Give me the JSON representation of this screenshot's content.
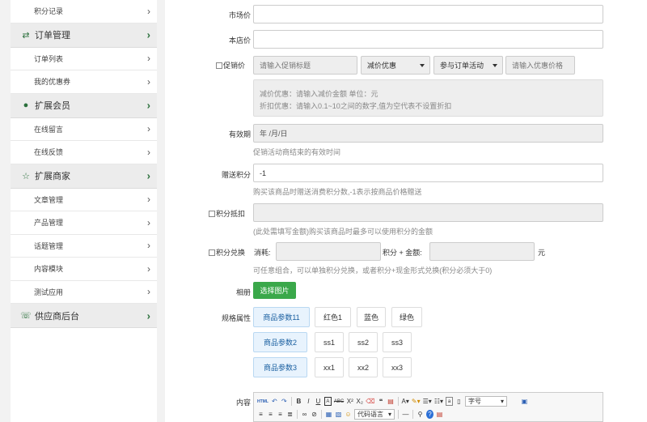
{
  "sidebar": {
    "items": [
      {
        "type": "sub",
        "label": "积分记录"
      },
      {
        "type": "head",
        "label": "订单管理",
        "icon": "transfer-icon"
      },
      {
        "type": "sub",
        "label": "订单列表"
      },
      {
        "type": "sub",
        "label": "我的优惠券"
      },
      {
        "type": "head",
        "label": "扩展会员",
        "icon": "user-icon"
      },
      {
        "type": "sub",
        "label": "在线留言"
      },
      {
        "type": "sub",
        "label": "在线反馈"
      },
      {
        "type": "head",
        "label": "扩展商家",
        "icon": "star-icon"
      },
      {
        "type": "sub",
        "label": "文章管理"
      },
      {
        "type": "sub",
        "label": "产品管理"
      },
      {
        "type": "sub",
        "label": "话题管理"
      },
      {
        "type": "sub",
        "label": "内容模块"
      },
      {
        "type": "sub",
        "label": "测试应用"
      },
      {
        "type": "head",
        "label": "供应商后台",
        "icon": "chat-icon"
      }
    ]
  },
  "form": {
    "market_price_label": "市场价",
    "shop_price_label": "本店价",
    "promo_label": "促销价",
    "promo_title_placeholder": "请输入促销标题",
    "promo_type_value": "减价优惠",
    "promo_activity_value": "参与订单活动",
    "promo_price_placeholder": "请输入优惠价格",
    "promo_note_1": "减价优惠：请输入减价金额 单位：元",
    "promo_note_2": "折扣优惠：请输入0.1~10之间的数字,值为空代表不设置折扣",
    "validity_label": "有效期",
    "validity_value": "年 /月/日",
    "validity_hint": "促销活动商结束的有效时间",
    "gift_points_label": "赠送积分",
    "gift_points_value": "-1",
    "gift_points_hint": "购买该商品时赠送消费积分数,-1表示按商品价格赠送",
    "points_deduct_label": "积分抵扣",
    "points_deduct_hint": "(此处需填写金额)购买该商品时最多可以使用积分的金额",
    "points_exchange_label": "积分兑换",
    "consume_label": "消耗:",
    "points_plus_amount_label": "积分 + 金额:",
    "yuan_label": "元",
    "points_exchange_hint": "可任意组合，可以单独积分兑换，或者积分+现金形式兑换(积分必须大于0)",
    "album_label": "相册",
    "select_image_button": "选择图片",
    "spec_label": "规格属性",
    "spec_rows": [
      {
        "key": "商品参数11",
        "values": [
          "红色1",
          "蓝色",
          "绿色"
        ]
      },
      {
        "key": "商品参数2",
        "values": [
          "ss1",
          "ss2",
          "ss3"
        ]
      },
      {
        "key": "商品参数3",
        "values": [
          "xx1",
          "xx2",
          "xx3"
        ]
      }
    ],
    "content_label": "内容"
  },
  "editor": {
    "html_label": "HTML",
    "font_size_value": "字号",
    "code_lang_value": "代码语言"
  }
}
